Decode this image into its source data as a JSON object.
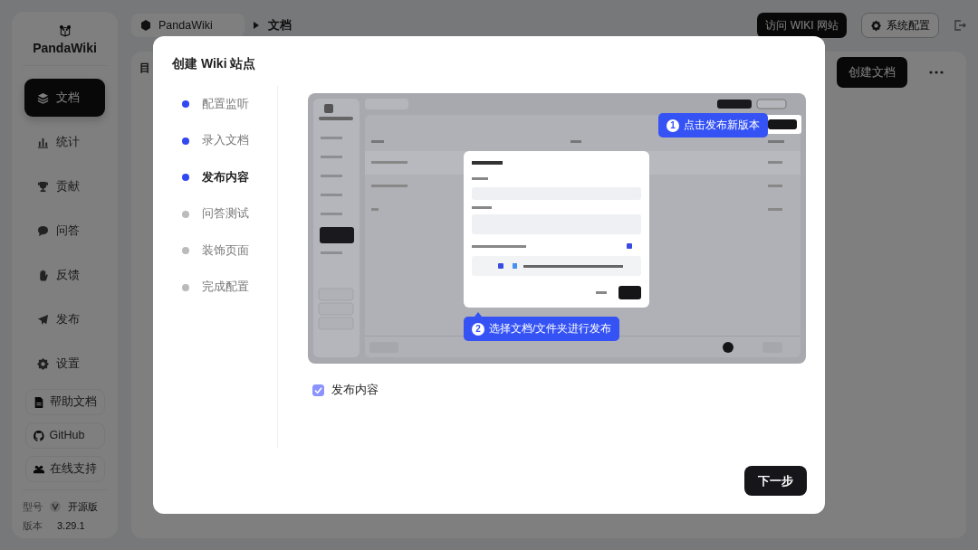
{
  "sidebar": {
    "logo_text": "PandaWiki",
    "items": [
      {
        "label": "文档",
        "selected": true
      },
      {
        "label": "统计",
        "selected": false
      },
      {
        "label": "贡献",
        "selected": false
      },
      {
        "label": "问答",
        "selected": false
      },
      {
        "label": "反馈",
        "selected": false
      },
      {
        "label": "发布",
        "selected": false
      },
      {
        "label": "设置",
        "selected": false
      }
    ],
    "links": [
      "帮助文档",
      "GitHub",
      "在线支持"
    ],
    "edition_label": "型号",
    "edition": "开源版",
    "version_label": "版本",
    "version": "3.29.1"
  },
  "topbar": {
    "breadcrumb": [
      "PandaWiki",
      "文档"
    ],
    "visit_button": "访问 WIKI 网站",
    "settings_button": "系统配置"
  },
  "main": {
    "heading": "目",
    "create_button": "创建文档"
  },
  "modal": {
    "title": "创建 Wiki 站点",
    "steps": [
      {
        "label": "配置监听",
        "done": true,
        "selected": false
      },
      {
        "label": "录入文档",
        "done": true,
        "selected": false
      },
      {
        "label": "发布内容",
        "done": true,
        "selected": true
      },
      {
        "label": "问答测试",
        "done": false,
        "selected": false
      },
      {
        "label": "装饰页面",
        "done": false,
        "selected": false
      },
      {
        "label": "完成配置",
        "done": false,
        "selected": false
      }
    ],
    "callouts": [
      {
        "number": "1",
        "text": "点击发布新版本"
      },
      {
        "number": "2",
        "text": "选择文档/文件夹进行发布"
      }
    ],
    "checkbox": {
      "label": "发布内容",
      "checked": true
    },
    "next_button": "下一步"
  }
}
